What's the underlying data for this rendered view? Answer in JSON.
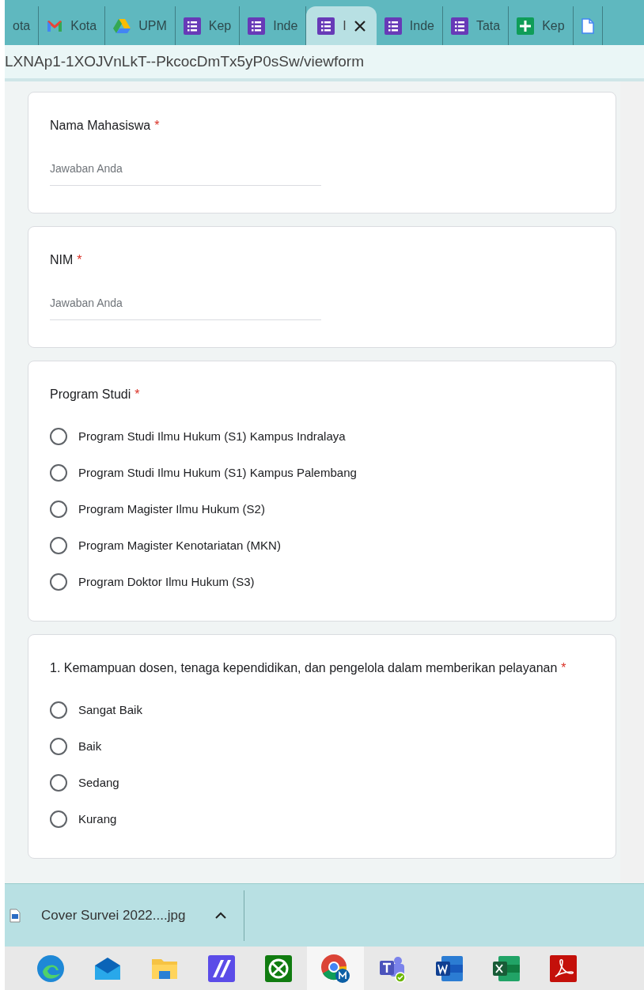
{
  "tabs": [
    {
      "label": "ota",
      "kind": "none",
      "selected": false
    },
    {
      "label": "Kota",
      "kind": "mail",
      "selected": false
    },
    {
      "label": "UPM",
      "kind": "drive",
      "selected": false
    },
    {
      "label": "Kep",
      "kind": "form",
      "selected": false
    },
    {
      "label": "Inde",
      "kind": "form",
      "selected": false
    },
    {
      "label": "I",
      "kind": "form",
      "selected": true
    },
    {
      "label": "Inde",
      "kind": "form",
      "selected": false
    },
    {
      "label": "Tata",
      "kind": "form",
      "selected": false
    },
    {
      "label": "Kep",
      "kind": "sheet",
      "selected": false
    },
    {
      "kind": "doc",
      "selected": false
    }
  ],
  "address": "LXNAp1-1XOJVnLkT--PkcocDmTx5yP0sSw/viewform",
  "questions": [
    {
      "kind": "text",
      "title": "Nama Mahasiswa",
      "required_mark": "*",
      "placeholder": "Jawaban Anda"
    },
    {
      "kind": "text",
      "title": "NIM",
      "required_mark": "*",
      "placeholder": "Jawaban Anda"
    },
    {
      "kind": "radio",
      "title": "Program Studi",
      "required_mark": "*",
      "options": [
        {
          "label": "Program Studi Ilmu Hukum (S1) Kampus Indralaya",
          "selected": false
        },
        {
          "label": "Program Studi Ilmu Hukum (S1) Kampus Palembang",
          "selected": false
        },
        {
          "label": "Program Magister Ilmu Hukum (S2)",
          "selected": false
        },
        {
          "label": "Program Magister Kenotariatan (MKN)",
          "selected": false
        },
        {
          "label": "Program Doktor Ilmu Hukum (S3)",
          "selected": false
        }
      ]
    },
    {
      "kind": "radio",
      "title": "1.  Kemampuan dosen, tenaga kependidikan, dan pengelola dalam memberikan pelayanan",
      "required_mark": "*",
      "options": [
        {
          "label": "Sangat Baik",
          "selected": false
        },
        {
          "label": "Baik",
          "selected": false
        },
        {
          "label": "Sedang",
          "selected": false
        },
        {
          "label": "Kurang",
          "selected": false
        }
      ]
    }
  ],
  "download": {
    "filename": "Cover Survei 2022....jpg"
  },
  "taskbar": [
    {
      "kind": "edge",
      "selected": false
    },
    {
      "kind": "mail",
      "selected": false
    },
    {
      "kind": "folder",
      "selected": false
    },
    {
      "kind": "app",
      "selected": false
    },
    {
      "kind": "xbox",
      "selected": false
    },
    {
      "kind": "chrome",
      "selected": true
    },
    {
      "kind": "teams",
      "selected": false
    },
    {
      "kind": "word",
      "selected": false
    },
    {
      "kind": "excel",
      "selected": false
    },
    {
      "kind": "pdf",
      "selected": false
    }
  ]
}
